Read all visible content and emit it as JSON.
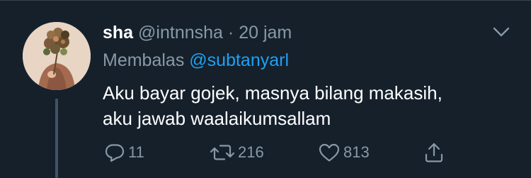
{
  "tweet": {
    "display_name": "sha",
    "handle": "@intnnsha",
    "separator": "·",
    "time": "20 jam",
    "reply_prefix": "Membalas",
    "reply_mention": "@subtanyarl",
    "text_lines": [
      "Aku bayar gojek, masnya bilang makasih,",
      "aku jawab waalaikumsallam"
    ],
    "reply_count": "11",
    "retweet_count": "216",
    "like_count": "813"
  },
  "icons": {
    "menu": "chevron-down-icon",
    "reply": "reply-bubble-icon",
    "retweet": "retweet-icon",
    "like": "heart-icon",
    "share": "share-upload-icon"
  },
  "colors": {
    "background": "#15202b",
    "muted": "#8899a6",
    "accent": "#1da1f2",
    "text": "#ffffff"
  }
}
